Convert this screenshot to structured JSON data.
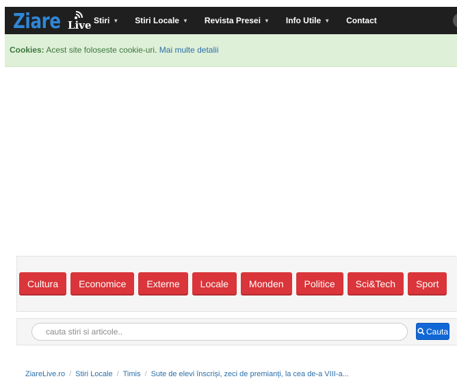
{
  "navbar": {
    "brand_main": "Ziare",
    "brand_live": "Live",
    "items": [
      {
        "label": "Stiri",
        "dropdown": true
      },
      {
        "label": "Stiri Locale",
        "dropdown": true
      },
      {
        "label": "Revista Presei",
        "dropdown": true
      },
      {
        "label": "Info Utile",
        "dropdown": true
      },
      {
        "label": "Contact",
        "dropdown": false
      }
    ],
    "caret": "▼"
  },
  "cookie": {
    "label": "Cookies:",
    "text": "Acest site foloseste cookie-uri.",
    "link": "Mai multe detalii"
  },
  "categories": [
    "Cultura",
    "Economice",
    "Externe",
    "Locale",
    "Monden",
    "Politice",
    "Sci&Tech",
    "Sport"
  ],
  "search": {
    "placeholder": "cauta stiri si articole..",
    "button_label": "Cauta",
    "icon": "search-icon"
  },
  "breadcrumb": {
    "items": [
      "ZiareLive.ro",
      "Stiri Locale",
      "Timis"
    ],
    "current": "Sute de elevi înscriși, zeci de premianți, la cea de-a VIII-a...",
    "separator": "/"
  },
  "colors": {
    "navbar_bg": "#1f1f1f",
    "brand_blue": "#2f86d6",
    "cookie_bg": "#dff0d8",
    "category_red": "#d9353a",
    "search_blue": "#1167d6",
    "link_blue": "#2a6ea8"
  }
}
